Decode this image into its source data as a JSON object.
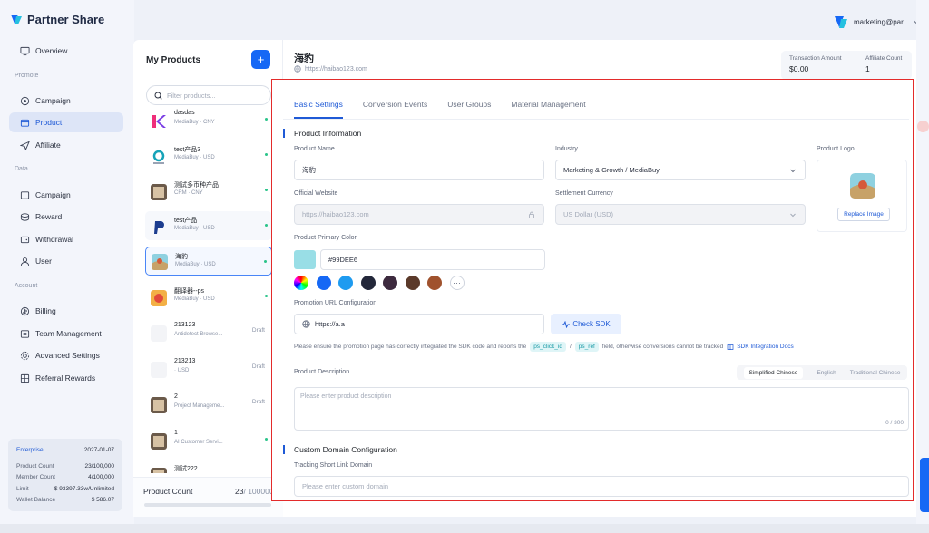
{
  "brand": {
    "name": "Partner Share",
    "accent": "#1668f5"
  },
  "user": {
    "name": "marketing@par..."
  },
  "nav": {
    "overview": "Overview",
    "promote_label": "Promote",
    "promote": [
      "Campaign",
      "Product",
      "Affiliate"
    ],
    "data_label": "Data",
    "data": [
      "Campaign",
      "Reward",
      "Withdrawal",
      "User"
    ],
    "account_label": "Account",
    "account": [
      "Billing",
      "Team Management",
      "Advanced Settings",
      "Referral Rewards"
    ]
  },
  "enterprise": {
    "plan": "Enterprise",
    "expiry": "2027-01-07",
    "rows": [
      {
        "k": "Product Count",
        "v": "23/100,000"
      },
      {
        "k": "Member Count",
        "v": "4/100,000"
      },
      {
        "k": "Limit",
        "v": "$ 93397.33w/Unlimited"
      },
      {
        "k": "Wallet Balance",
        "v": "$ 586.07"
      }
    ]
  },
  "products": {
    "title": "My Products",
    "add_icon": "+",
    "filter_placeholder": "Filter products...",
    "items": [
      {
        "name": "dasdas",
        "meta": "MediaBuy · CNY",
        "status": "active"
      },
      {
        "name": "test产品3",
        "meta": "MediaBuy · USD",
        "status": "active"
      },
      {
        "name": "测试多币种产品",
        "meta": "CRM · CNY",
        "status": "active"
      },
      {
        "name": "test产品",
        "meta": "MediaBuy · USD",
        "status": "active"
      },
      {
        "name": "海豹",
        "meta": "MediaBuy · USD",
        "status": "active"
      },
      {
        "name": "翻译器--ps",
        "meta": "MediaBuy · USD",
        "status": "active"
      },
      {
        "name": "213123",
        "meta": "Antidetect Browse...",
        "status": "Draft"
      },
      {
        "name": "213213",
        "meta": "· USD",
        "status": "Draft"
      },
      {
        "name": "2",
        "meta": "Project Manageme...",
        "status": "Draft"
      },
      {
        "name": "1",
        "meta": "AI Customer Servi...",
        "status": "active"
      },
      {
        "name": "测试222",
        "meta": "",
        "status": ""
      }
    ],
    "footer_label": "Product Count",
    "footer_count": "23",
    "footer_total": "/ 100000"
  },
  "detail": {
    "name": "海豹",
    "url": "https://haibao123.com",
    "stats": [
      {
        "label": "Transaction Amount",
        "value": "$0.00"
      },
      {
        "label": "Affiliate Count",
        "value": "1"
      }
    ],
    "tabs": [
      "Basic Settings",
      "Conversion Events",
      "User Groups",
      "Material Management"
    ],
    "section_info": "Product Information",
    "product_name_label": "Product Name",
    "product_name": "海豹",
    "industry_label": "Industry",
    "industry": "Marketing & Growth / MediaBuy",
    "logo_label": "Product Logo",
    "replace_image": "Replace Image",
    "website_label": "Official Website",
    "website": "https://haibao123.com",
    "currency_label": "Settlement Currency",
    "currency": "US Dollar (USD)",
    "color_label": "Product Primary Color",
    "color_value": "#99DEE6",
    "palette": [
      "#1668f5",
      "#1e9bf0",
      "#23283a",
      "#3d2a3e",
      "#5b3a2a",
      "#a0522d"
    ],
    "promo_label": "Promotion URL Configuration",
    "promo_url": "https://a.a",
    "check_sdk": "Check SDK",
    "note_pre": "Please ensure the promotion page has correctly integrated the SDK code and reports the",
    "param1": "ps_click_id",
    "slash": "/",
    "param2": "ps_ref",
    "note_post": "field, otherwise conversions cannot be tracked",
    "sdk_docs": "SDK Integration Docs",
    "desc_label": "Product Description",
    "langs": [
      "Simplified Chinese",
      "English",
      "Traditional Chinese"
    ],
    "desc_placeholder": "Please enter product description",
    "desc_count": "0 / 300",
    "section_domain": "Custom Domain Configuration",
    "domain_label": "Tracking Short Link Domain",
    "domain_placeholder": "Please enter custom domain"
  }
}
